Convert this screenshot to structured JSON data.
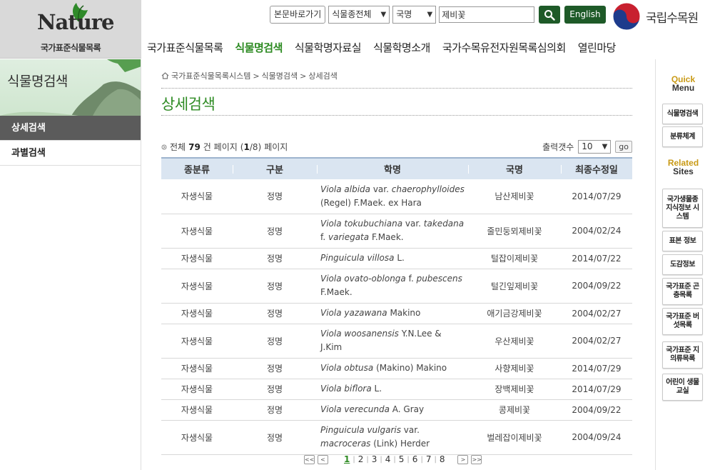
{
  "header": {
    "logo_word": "Nature",
    "logo_sub": "국가표준식물목록",
    "skip_label": "본문바로가기",
    "kind_select": "식물종전체",
    "field_select": "국명",
    "search_value": "제비꽃",
    "english_label": "English",
    "org_name": "국립수목원",
    "colors": {
      "accent_green": "#2e8b23",
      "button_green": "#1e5a28"
    }
  },
  "gnb": [
    {
      "label": "국가표준식물목록",
      "active": false
    },
    {
      "label": "식물명검색",
      "active": true
    },
    {
      "label": "식물학명자료실",
      "active": false
    },
    {
      "label": "식물학명소개",
      "active": false
    },
    {
      "label": "국가수목유전자원목록심의회",
      "active": false
    },
    {
      "label": "열린마당",
      "active": false
    }
  ],
  "lnb": {
    "title": "식물명검색",
    "items": [
      {
        "label": "상세검색",
        "active": true
      },
      {
        "label": "과별검색",
        "active": false
      }
    ]
  },
  "breadcrumb": [
    "국가표준식물목록시스템",
    "식물명검색",
    "상세검색"
  ],
  "page_title": "상세검색",
  "summary": {
    "prefix": "전체",
    "total": "79",
    "unit": "건 페이지",
    "page": "(1/8)",
    "suffix": "페이지"
  },
  "per_page": {
    "label": "출력갯수",
    "value": "10",
    "go_label": "go"
  },
  "table": {
    "headers": [
      "종분류",
      "구분",
      "학명",
      "국명",
      "최종수정일"
    ],
    "rows": [
      {
        "kind": "자생식물",
        "type": "정명",
        "sci": [
          [
            "i",
            "Viola albida"
          ],
          [
            "t",
            " var. "
          ],
          [
            "i",
            "chaerophylloides"
          ],
          [
            "t",
            " (Regel) F.Maek. ex Hara"
          ]
        ],
        "name": "남산제비꽃",
        "date": "2014/07/29"
      },
      {
        "kind": "자생식물",
        "type": "정명",
        "sci": [
          [
            "i",
            "Viola tokubuchiana"
          ],
          [
            "t",
            " var. "
          ],
          [
            "i",
            "takedana"
          ],
          [
            "t",
            " f. "
          ],
          [
            "i",
            "variegata"
          ],
          [
            "t",
            " F.Maek."
          ]
        ],
        "name": "줄민둥뫼제비꽃",
        "date": "2004/02/24"
      },
      {
        "kind": "자생식물",
        "type": "정명",
        "sci": [
          [
            "i",
            "Pinguicula villosa"
          ],
          [
            "t",
            " L."
          ]
        ],
        "name": "털잡이제비꽃",
        "date": "2014/07/22"
      },
      {
        "kind": "자생식물",
        "type": "정명",
        "sci": [
          [
            "i",
            "Viola ovato-oblonga"
          ],
          [
            "t",
            " f. "
          ],
          [
            "i",
            "pubescens"
          ],
          [
            "t",
            " F.Maek."
          ]
        ],
        "name": "털긴잎제비꽃",
        "date": "2004/09/22"
      },
      {
        "kind": "자생식물",
        "type": "정명",
        "sci": [
          [
            "i",
            "Viola yazawana"
          ],
          [
            "t",
            " Makino"
          ]
        ],
        "name": "애기금강제비꽃",
        "date": "2004/02/27"
      },
      {
        "kind": "자생식물",
        "type": "정명",
        "sci": [
          [
            "i",
            "Viola woosanensis"
          ],
          [
            "t",
            " Y.N.Lee & J.Kim"
          ]
        ],
        "name": "우산제비꽃",
        "date": "2004/02/27"
      },
      {
        "kind": "자생식물",
        "type": "정명",
        "sci": [
          [
            "i",
            "Viola obtusa"
          ],
          [
            "t",
            " (Makino) Makino"
          ]
        ],
        "name": "사향제비꽃",
        "date": "2014/07/29"
      },
      {
        "kind": "자생식물",
        "type": "정명",
        "sci": [
          [
            "i",
            "Viola biflora"
          ],
          [
            "t",
            " L."
          ]
        ],
        "name": "장백제비꽃",
        "date": "2014/07/29"
      },
      {
        "kind": "자생식물",
        "type": "정명",
        "sci": [
          [
            "i",
            "Viola verecunda"
          ],
          [
            "t",
            " A. Gray"
          ]
        ],
        "name": "콩제비꽃",
        "date": "2004/09/22"
      },
      {
        "kind": "자생식물",
        "type": "정명",
        "sci": [
          [
            "i",
            "Pinguicula vulgaris"
          ],
          [
            "t",
            " var. "
          ],
          [
            "i",
            "macroceras"
          ],
          [
            "t",
            " (Link) Herder"
          ]
        ],
        "name": "벌레잡이제비꽃",
        "date": "2004/09/24"
      }
    ]
  },
  "pager": {
    "pages": [
      "1",
      "2",
      "3",
      "4",
      "5",
      "6",
      "7",
      "8"
    ],
    "current": "1",
    "first": "<<",
    "prev": "<",
    "next": ">",
    "last": ">>"
  },
  "quick": {
    "head1": [
      "Quick",
      "Menu"
    ],
    "menu": [
      "식물명검색",
      "분류체계"
    ],
    "head2": [
      "Related",
      "Sites"
    ],
    "sites": [
      "국가생물종 지식정보 시스템",
      "표본 정보",
      "도감정보",
      "국가표준 곤충목록",
      "국가표준 버섯목록",
      "국가표준 지의류목록",
      "어린이 생물교실"
    ]
  }
}
